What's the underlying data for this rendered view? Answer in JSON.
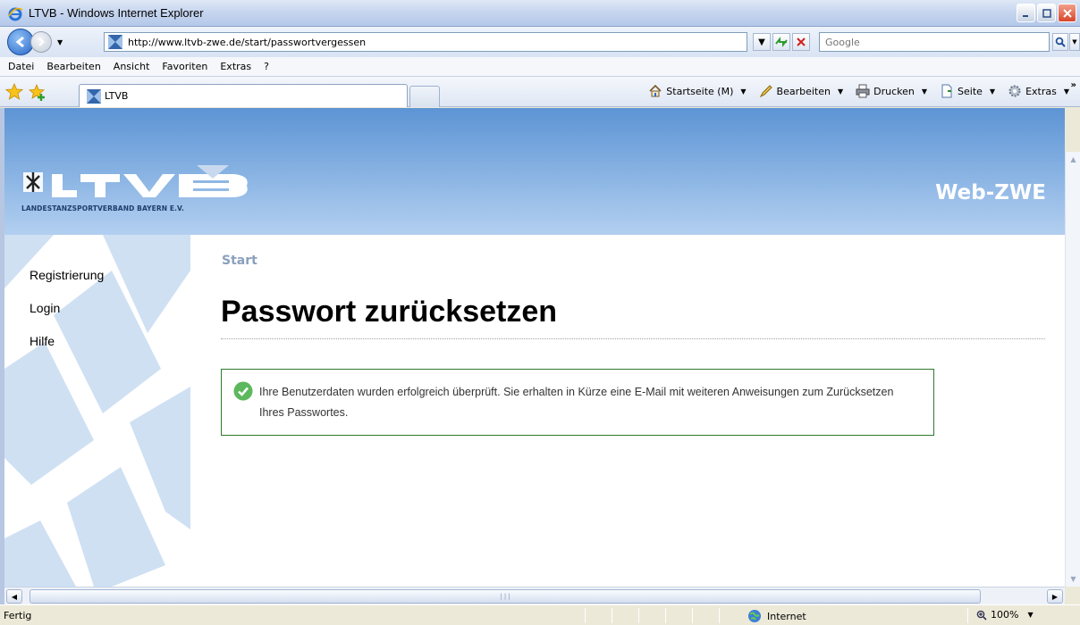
{
  "window": {
    "title": "LTVB - Windows Internet Explorer"
  },
  "address": {
    "url": "http://www.ltvb-zwe.de/start/passwortvergessen",
    "search_placeholder": "Google"
  },
  "menu": {
    "items": [
      "Datei",
      "Bearbeiten",
      "Ansicht",
      "Favoriten",
      "Extras",
      "?"
    ]
  },
  "tabs": {
    "active_label": "LTVB"
  },
  "commandbar": {
    "home_label": "Startseite (M)",
    "edit_label": "Bearbeiten",
    "print_label": "Drucken",
    "page_label": "Seite",
    "tools_label": "Extras"
  },
  "site": {
    "logo_tagline": "LANDESTANZSPORTVERBAND BAYERN E.V.",
    "product_name": "Web-ZWE",
    "nav": [
      "Registrierung",
      "Login",
      "Hilfe"
    ],
    "breadcrumb": "Start",
    "page_title": "Passwort zurücksetzen",
    "success_message": "Ihre Benutzerdaten wurden erfolgreich überprüft. Sie erhalten in Kürze eine E-Mail mit weiteren Anweisungen zum Zurücksetzen Ihres Passwortes."
  },
  "status": {
    "text": "Fertig",
    "zone": "Internet",
    "zoom": "100%"
  },
  "colors": {
    "banner": "#79a8de",
    "success_border": "#2f7a2f",
    "success_icon": "#5cb85c",
    "breadcrumb": "#8aa0bc"
  }
}
